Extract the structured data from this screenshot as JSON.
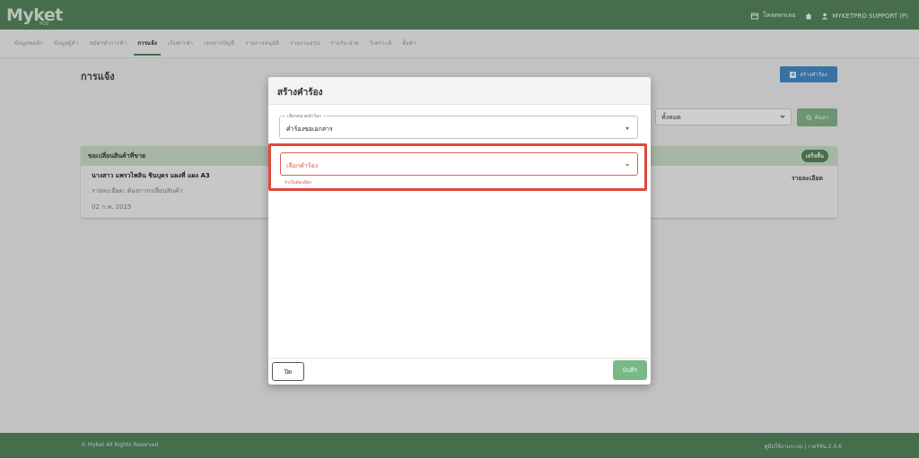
{
  "app": {
    "logo": "Myket",
    "logo_sub": "POS",
    "topbar": {
      "file_link": "โหลดทรเลอ",
      "user": "MYKETPRO SUPPORT (P)"
    }
  },
  "nav": {
    "tabs": [
      "ข้อมูลพอค้า",
      "ข้อมูลผู้ค้า",
      "สมัครทำการค้า",
      "การแจ้ง",
      "เก็บค่าเช่า",
      "เอกสารบัญชี",
      "รายการอนุมัติ",
      "รายงานสรุป",
      "รายรับ-จ่าย",
      "วิเคราะห์",
      "ตั้งค่า"
    ],
    "active_index": 3
  },
  "page": {
    "title": "การแจ้ง",
    "create_button": "สร้างคำร้อง",
    "filter_value": "ทั้งหมด",
    "search_button": "ค้นหา"
  },
  "card": {
    "header": "ขอเปลี่ยนสินค้าที่ขาย",
    "badge": "เสร็จสิ้น",
    "name_line": "นางสาว แพรวไพลิน ชินบุตร แผงที่ แผง A3",
    "detail_line": "รายละเอียด: ต้องการเปลี่ยนสินค้า",
    "date": "02 ก.พ. 2025",
    "detail_button": "รายละเอียด"
  },
  "footer": {
    "left": "© MyKet All Rights Reserved",
    "right": "คู่มือใช้งานระบบ | เวอร์ชัน 2.0.6"
  },
  "modal": {
    "title": "สร้างคำร้อง",
    "category_label": "เลือกหมวดคำร้อง",
    "category_value": "คำร้องขอเอกสาร",
    "request_placeholder": "เลือกคำร้อง",
    "request_helper": "จำเป็นต้องเลือก",
    "close_button": "ปิด",
    "save_button": "บันทึก"
  },
  "colors": {
    "brand_green": "#4e7a55",
    "error_red": "#e2483a",
    "primary_blue": "#3f7fb8",
    "save_green": "#7ab888"
  }
}
